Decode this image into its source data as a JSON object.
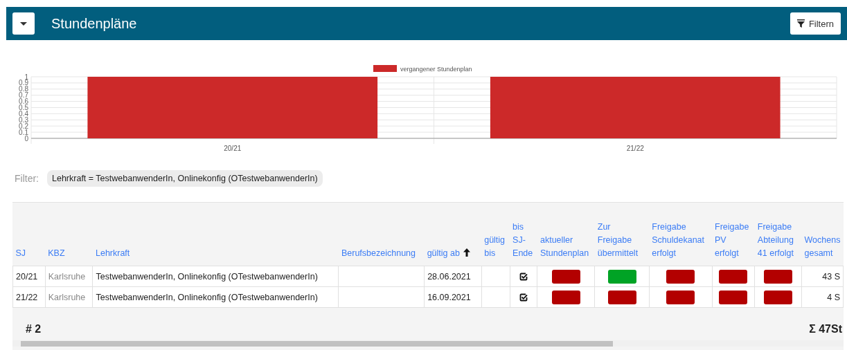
{
  "header": {
    "title": "Stundenpläne",
    "filter_button": "Filtern"
  },
  "chart_data": {
    "type": "bar",
    "categories": [
      "20/21",
      "21/22"
    ],
    "series": [
      {
        "name": "vergangener Stundenplan",
        "color": "#cc2929",
        "values": [
          1,
          1
        ]
      }
    ],
    "ylim": [
      0,
      1
    ],
    "grid": true,
    "yticks": [
      0,
      0.1,
      0.2,
      0.3,
      0.4,
      0.5,
      0.6,
      0.7,
      0.8,
      0.9,
      1
    ]
  },
  "filter": {
    "label": "Filter:",
    "chips": [
      "Lehrkraft = TestwebanwenderIn, Onlinekonfig (OTestwebanwenderIn)"
    ]
  },
  "table": {
    "columns": [
      {
        "label": "SJ",
        "kind": "text",
        "sorted": false
      },
      {
        "label": "KBZ",
        "kind": "muted",
        "sorted": false
      },
      {
        "label": "Lehrkraft",
        "kind": "text",
        "sorted": false
      },
      {
        "label": "Berufsbezeichnung",
        "kind": "text",
        "sorted": false
      },
      {
        "label": "gültig ab",
        "kind": "text",
        "sorted": true
      },
      {
        "label": "gültig bis",
        "kind": "text",
        "sorted": false
      },
      {
        "label": "bis SJ-Ende",
        "kind": "check",
        "sorted": false
      },
      {
        "label": "aktueller Stundenplan",
        "kind": "status",
        "sorted": false
      },
      {
        "label": "Zur Freigabe übermittelt",
        "kind": "status",
        "sorted": false
      },
      {
        "label": "Freigabe Schuldekanat erfolgt",
        "kind": "status",
        "sorted": false
      },
      {
        "label": "Freigabe PV erfolgt",
        "kind": "status",
        "sorted": false
      },
      {
        "label": "Freigabe Abteilung 41 erfolgt",
        "kind": "status",
        "sorted": false
      },
      {
        "label": "Wochens gesamt",
        "kind": "number",
        "sorted": false
      }
    ],
    "rows": [
      {
        "cells": [
          "20/21",
          "Karlsruhe",
          "TestwebanwenderIn, Onlinekonfig (OTestwebanwenderIn)",
          "",
          "28.06.2021",
          "",
          {
            "checked": true
          },
          {
            "color": "#b30000"
          },
          {
            "color": "#00a325"
          },
          {
            "color": "#b30000"
          },
          {
            "color": "#b30000"
          },
          {
            "color": "#b30000"
          },
          "43 S"
        ]
      },
      {
        "cells": [
          "21/22",
          "Karlsruhe",
          "TestwebanwenderIn, Onlinekonfig (OTestwebanwenderIn)",
          "",
          "16.09.2021",
          "",
          {
            "checked": true
          },
          {
            "color": "#b30000"
          },
          {
            "color": "#b30000"
          },
          {
            "color": "#b30000"
          },
          {
            "color": "#b30000"
          },
          {
            "color": "#b30000"
          },
          "4 S"
        ]
      }
    ],
    "footer": {
      "count": "# 2",
      "sum": "Σ 47St"
    }
  }
}
